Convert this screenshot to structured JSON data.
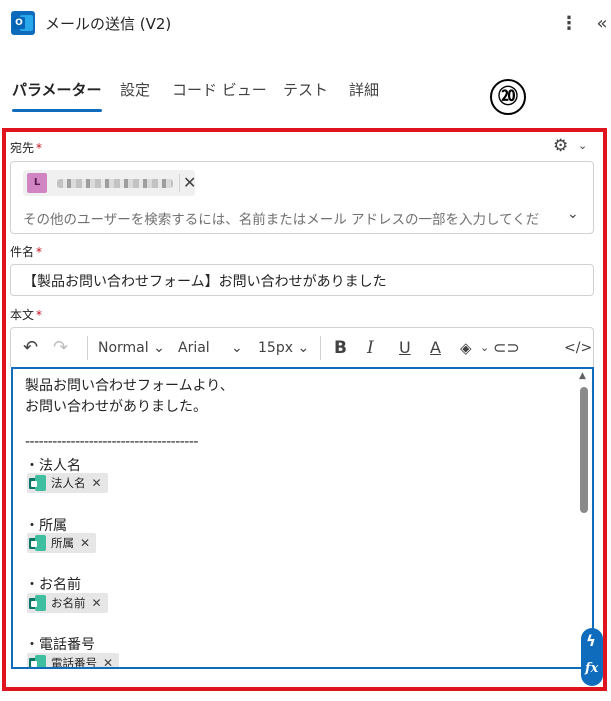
{
  "header": {
    "app_icon": "outlook-icon",
    "app_icon_letter": "O",
    "title": "メールの送信 (V2)",
    "more_icon": "more-vertical-icon",
    "collapse_icon": "collapse-panel-icon"
  },
  "tabs": [
    {
      "label": "パラメーター",
      "active": true
    },
    {
      "label": "設定",
      "active": false
    },
    {
      "label": "コード ビュー",
      "active": false
    },
    {
      "label": "テスト",
      "active": false
    },
    {
      "label": "詳細",
      "active": false
    }
  ],
  "annotation": {
    "number": "⑳"
  },
  "fields": {
    "to": {
      "label": "宛先",
      "required_mark": "*",
      "recipient_avatar": "L",
      "placeholder": "その他のユーザーを検索するには、名前またはメール アドレスの一部を入力してくだ"
    },
    "subject": {
      "label": "件名",
      "required_mark": "*",
      "value": "【製品お問い合わせフォーム】お問い合わせがありました"
    },
    "body": {
      "label": "本文",
      "required_mark": "*",
      "toolbar": {
        "format": "Normal",
        "font": "Arial",
        "size": "15px"
      },
      "lines": [
        "製品お問い合わせフォームより、",
        "お問い合わせがありました。",
        "--------------------------------------",
        "・法人名",
        "・所属",
        "・お名前",
        "・電話番号"
      ],
      "tokens": [
        "法人名",
        "所属",
        "お名前",
        "電話番号"
      ]
    }
  },
  "colors": {
    "accent": "#0f6cbd",
    "highlight_frame": "#e0141e",
    "required": "#c50f1f",
    "forms_token": "#077568"
  }
}
